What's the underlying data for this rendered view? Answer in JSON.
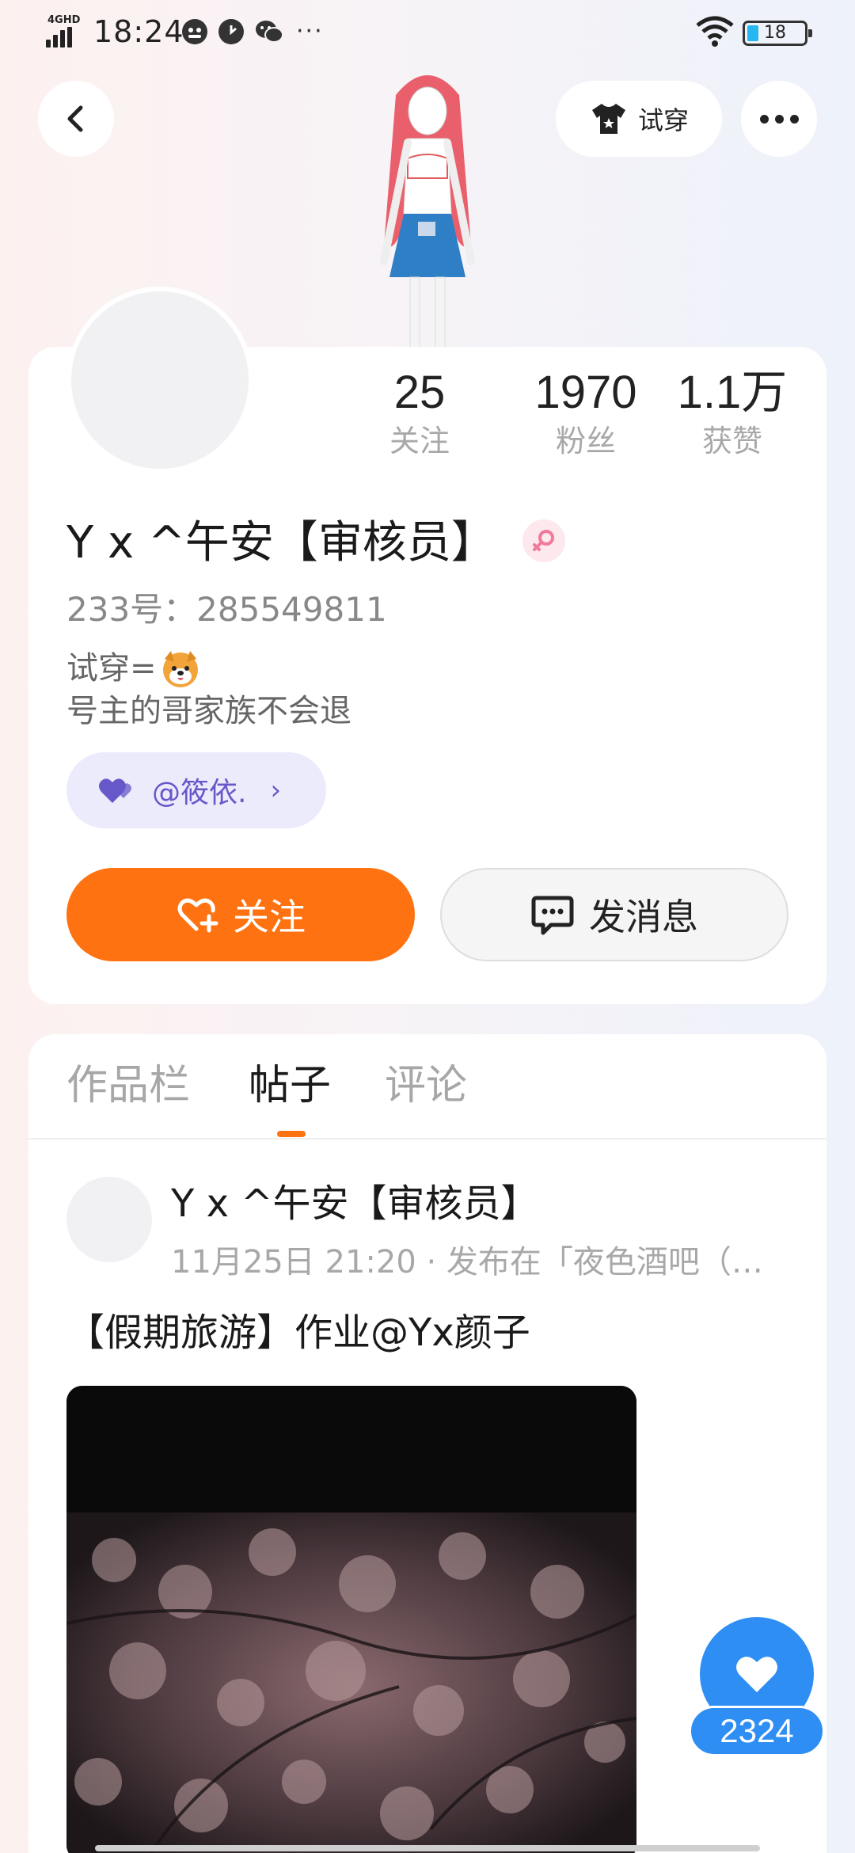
{
  "status_bar": {
    "network": "4GHD",
    "time": "18:24",
    "dots": "···",
    "battery": "18",
    "icons": [
      "signal-icon",
      "qq-app-icon",
      "clock-app-icon",
      "wechat-app-icon",
      "wifi-icon",
      "battery-icon"
    ]
  },
  "nav": {
    "tryon_label": "试穿",
    "icons": [
      "back-arrow-icon",
      "tshirt-icon",
      "more-icon"
    ]
  },
  "profile": {
    "stats": [
      {
        "value": "25",
        "label": "关注"
      },
      {
        "value": "1970",
        "label": "粉丝"
      },
      {
        "value": "1.1万",
        "label": "获赞"
      }
    ],
    "name": "Y x ^午安【审核员】",
    "gender_symbol": "♀",
    "id_text": "233号：285549811",
    "bio_line1": "试穿=",
    "bio_line2": "号主的哥家族不会退",
    "cp_tag": "@筱依.",
    "cp_chevron": "›",
    "follow_label": "关注",
    "message_label": "发消息"
  },
  "tabs": [
    "作品栏",
    "帖子",
    "评论"
  ],
  "active_tab": "帖子",
  "post": {
    "author": "Y x ^午安【审核员】",
    "meta": "11月25日 21:20 · 发布在「夜色酒吧（…",
    "text": "【假期旅游】作业@Yx颜子"
  },
  "like": {
    "count": "2324"
  },
  "colors": {
    "accent_orange": "#ff7212",
    "like_blue": "#2e8ef3",
    "cp_purple": "#6658c9",
    "cp_bg": "#ecebfb",
    "gender_pink": "#f07a9a"
  }
}
